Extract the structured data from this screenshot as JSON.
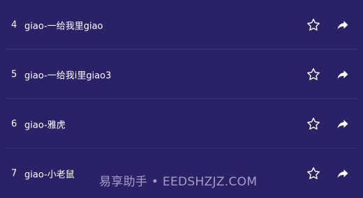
{
  "list": {
    "rows": [
      {
        "number": "4",
        "title": "giao-一给我里giao",
        "favorite_icon": "star-outline-icon",
        "share_icon": "share-arrow-icon"
      },
      {
        "number": "5",
        "title": "giao-一给我i里giao3",
        "favorite_icon": "star-outline-icon",
        "share_icon": "share-arrow-icon"
      },
      {
        "number": "6",
        "title": "giao-雅虎",
        "favorite_icon": "star-outline-icon",
        "share_icon": "share-arrow-icon"
      },
      {
        "number": "7",
        "title": "giao-小老鼠",
        "favorite_icon": "star-outline-icon",
        "share_icon": "share-arrow-icon"
      }
    ]
  },
  "watermark": "易享助手 • EEDSHZJZ.COM",
  "colors": {
    "background": "#2a2266",
    "separator": "#3a3378",
    "text": "#ffffff"
  }
}
